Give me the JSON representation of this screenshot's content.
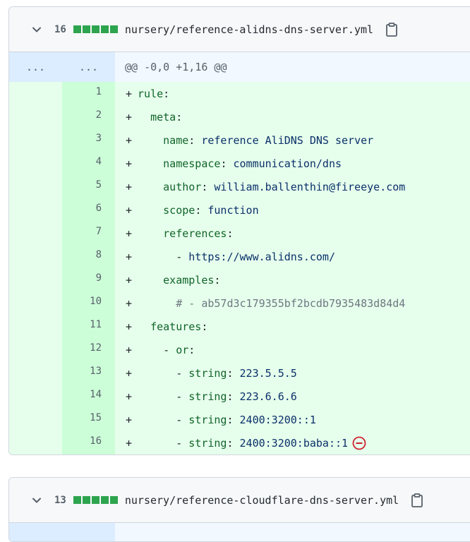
{
  "files": [
    {
      "changes": "16",
      "filename": "nursery/reference-alidns-dns-server.yml",
      "hunk_old_gutter": "...",
      "hunk_new_gutter": "...",
      "hunk_header": "@@ -0,0 +1,16 @@",
      "lines": [
        {
          "n": "1",
          "indent": "",
          "key": "rule",
          "sep": ":",
          "val": ""
        },
        {
          "n": "2",
          "indent": "  ",
          "key": "meta",
          "sep": ":",
          "val": ""
        },
        {
          "n": "3",
          "indent": "    ",
          "key": "name",
          "sep": ": ",
          "val": "reference AliDNS DNS server"
        },
        {
          "n": "4",
          "indent": "    ",
          "key": "namespace",
          "sep": ": ",
          "val": "communication/dns"
        },
        {
          "n": "5",
          "indent": "    ",
          "key": "author",
          "sep": ": ",
          "val": "william.ballenthin@fireeye.com"
        },
        {
          "n": "6",
          "indent": "    ",
          "key": "scope",
          "sep": ": ",
          "val": "function"
        },
        {
          "n": "7",
          "indent": "    ",
          "key": "references",
          "sep": ":",
          "val": ""
        },
        {
          "n": "8",
          "indent": "      - ",
          "key": "",
          "sep": "",
          "val": "https://www.alidns.com/"
        },
        {
          "n": "9",
          "indent": "    ",
          "key": "examples",
          "sep": ":",
          "val": ""
        },
        {
          "n": "10",
          "indent": "      ",
          "key": "",
          "sep": "",
          "val": "",
          "comment": "# - ab57d3c179355bf2bcdb7935483d84d4"
        },
        {
          "n": "11",
          "indent": "  ",
          "key": "features",
          "sep": ":",
          "val": ""
        },
        {
          "n": "12",
          "indent": "    - ",
          "key": "or",
          "sep": ":",
          "val": ""
        },
        {
          "n": "13",
          "indent": "      - ",
          "key": "string",
          "sep": ": ",
          "val": "223.5.5.5"
        },
        {
          "n": "14",
          "indent": "      - ",
          "key": "string",
          "sep": ": ",
          "val": "223.6.6.6"
        },
        {
          "n": "15",
          "indent": "      - ",
          "key": "string",
          "sep": ": ",
          "val": "2400:3200::1"
        },
        {
          "n": "16",
          "indent": "      - ",
          "key": "string",
          "sep": ": ",
          "val": "2400:3200:baba::1",
          "no_newline_icon": "no-entry-icon"
        }
      ]
    },
    {
      "changes": "13",
      "filename": "nursery/reference-cloudflare-dns-server.yml"
    }
  ],
  "icons": {
    "collapse": "chevron-down-icon",
    "copy": "clipboard-icon",
    "no_newline": "no-entry-icon"
  },
  "colors": {
    "added_block": "#2da44e",
    "added_line_bg": "#e6ffec",
    "added_gutter_bg": "#ccffd8",
    "hunk_bg": "#ddf4ff",
    "warn_red": "#cf222e"
  },
  "plus_sign": "+"
}
